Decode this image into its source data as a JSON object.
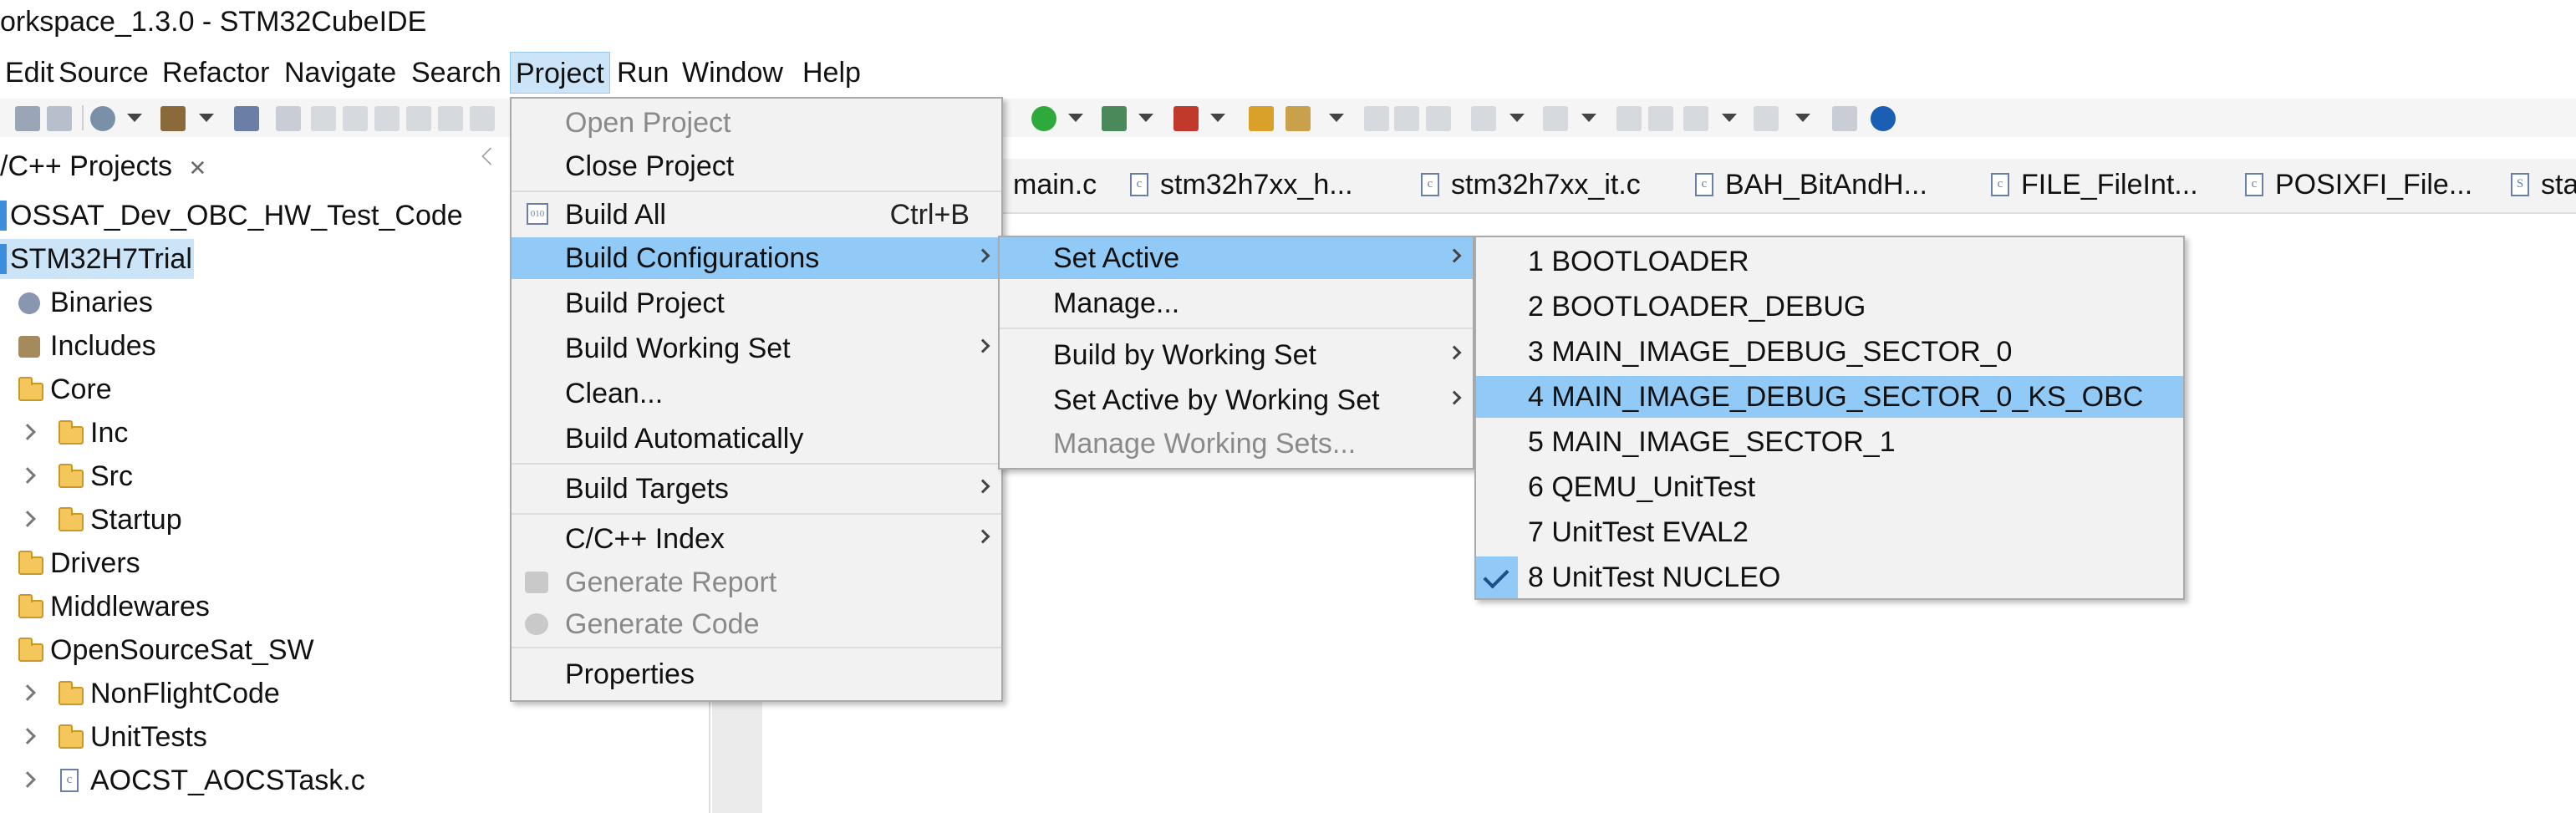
{
  "window": {
    "title": "orkspace_1.3.0 - STM32CubeIDE"
  },
  "menubar": {
    "items": [
      "Edit",
      "Source",
      "Refactor",
      "Navigate",
      "Search",
      "Project",
      "Run",
      "Window",
      "Help"
    ],
    "active": "Project"
  },
  "project_explorer": {
    "tab_label": "/C++ Projects",
    "close_glyph": "✕",
    "tree": [
      {
        "label": "OSSAT_Dev_OBC_HW_Test_Code"
      },
      {
        "label": "STM32H7Trial",
        "selected": true
      },
      {
        "label": "Binaries"
      },
      {
        "label": "Includes"
      },
      {
        "label": "Core"
      },
      {
        "label": "Inc"
      },
      {
        "label": "Src"
      },
      {
        "label": "Startup"
      },
      {
        "label": "Drivers"
      },
      {
        "label": "Middlewares"
      },
      {
        "label": "OpenSourceSat_SW"
      },
      {
        "label": "NonFlightCode"
      },
      {
        "label": "UnitTests"
      },
      {
        "label": "AOCST_AOCSTask.c"
      }
    ]
  },
  "editor_tabs": [
    "main.c",
    "stm32h7xx_h...",
    "stm32h7xx_it.c",
    "BAH_BitAndH...",
    "FILE_FileInt...",
    "POSIXFI_File...",
    "sta"
  ],
  "project_menu": {
    "items": [
      {
        "label": "Open Project",
        "disabled": true
      },
      {
        "label": "Close Project"
      },
      {
        "label": "Build All",
        "accelerator": "Ctrl+B"
      },
      {
        "label": "Build Configurations",
        "submenu": true,
        "highlighted": true
      },
      {
        "label": "Build Project"
      },
      {
        "label": "Build Working Set",
        "submenu": true
      },
      {
        "label": "Clean..."
      },
      {
        "label": "Build Automatically"
      },
      {
        "label": "Build Targets",
        "submenu": true
      },
      {
        "label": "C/C++ Index",
        "submenu": true
      },
      {
        "label": "Generate Report",
        "disabled": true
      },
      {
        "label": "Generate Code",
        "disabled": true
      },
      {
        "label": "Properties"
      }
    ]
  },
  "build_config_menu": {
    "items": [
      {
        "label": "Set Active",
        "submenu": true,
        "highlighted": true
      },
      {
        "label": "Manage..."
      },
      {
        "label": "Build by Working Set",
        "submenu": true
      },
      {
        "label": "Set Active by Working Set",
        "submenu": true
      },
      {
        "label": "Manage Working Sets...",
        "disabled": true
      }
    ]
  },
  "set_active_menu": {
    "items": [
      {
        "label": "1 BOOTLOADER"
      },
      {
        "label": "2 BOOTLOADER_DEBUG"
      },
      {
        "label": "3 MAIN_IMAGE_DEBUG_SECTOR_0"
      },
      {
        "label": "4 MAIN_IMAGE_DEBUG_SECTOR_0_KS_OBC",
        "highlighted": true
      },
      {
        "label": "5 MAIN_IMAGE_SECTOR_1"
      },
      {
        "label": "6 QEMU_UnitTest"
      },
      {
        "label": "7 UnitTest EVAL2"
      },
      {
        "label": "8 UnitTest NUCLEO",
        "checked": true
      }
    ]
  },
  "colors": {
    "highlight": "#91c9f7",
    "menu_bg": "#f2f2f2",
    "selection": "#cce4f7"
  }
}
